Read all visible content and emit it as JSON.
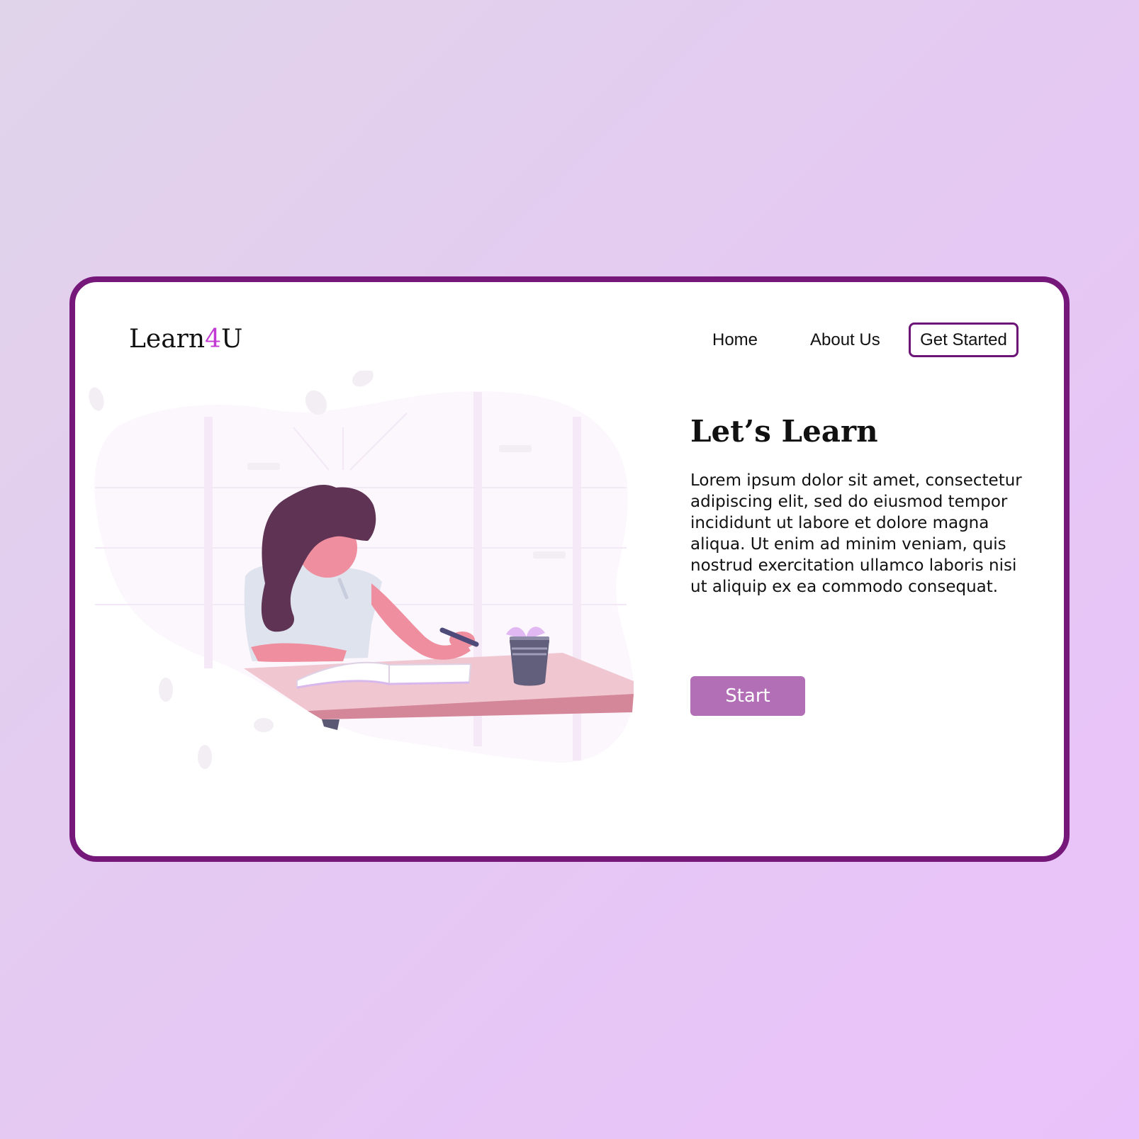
{
  "brand": {
    "logo_part1": "Learn",
    "logo_accent": "4",
    "logo_part2": "U",
    "accent_color": "#c23ad3",
    "frame_color": "#76187a"
  },
  "nav": {
    "home_label": "Home",
    "about_label": "About Us",
    "cta_label": "Get Started"
  },
  "hero": {
    "title": "Let’s Learn",
    "body": "Lorem ipsum dolor sit amet, consectetur adipiscing elit, sed do eiusmod tempor incididunt ut labore et dolore magna aliqua. Ut enim ad minim veniam, quis nostrud exercitation ullamco laboris nisi ut aliquip ex ea commodo consequat.",
    "start_label": "Start",
    "button_color": "#b26fb6"
  },
  "illustration": {
    "subject": "woman-studying-illustration"
  }
}
